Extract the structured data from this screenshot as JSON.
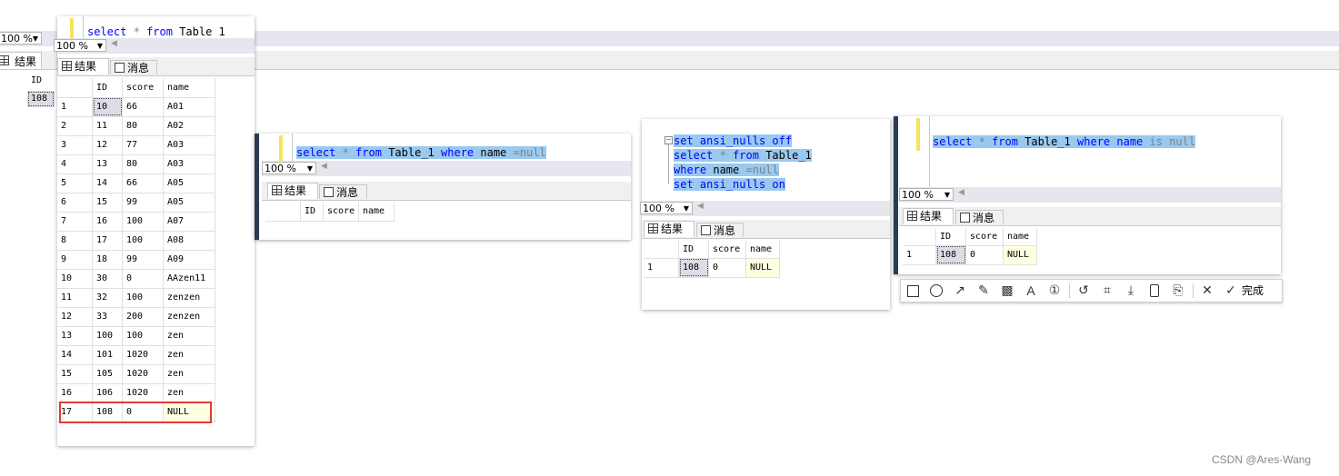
{
  "background_window": {
    "zoom": "100 %",
    "tab_results": "结果",
    "col_id": "ID",
    "cell_id": "108"
  },
  "panel1": {
    "sql": {
      "kw_select": "select",
      "star": "*",
      "kw_from": "from",
      "table": "Table 1"
    },
    "zoom": "100 %",
    "tab_results": "结果",
    "tab_messages": "消息",
    "columns": [
      "ID",
      "score",
      "name"
    ],
    "rows": [
      [
        "1",
        "10",
        "66",
        "A01"
      ],
      [
        "2",
        "11",
        "80",
        "A02"
      ],
      [
        "3",
        "12",
        "77",
        "A03"
      ],
      [
        "4",
        "13",
        "80",
        "A03"
      ],
      [
        "5",
        "14",
        "66",
        "A05"
      ],
      [
        "6",
        "15",
        "99",
        "A05"
      ],
      [
        "7",
        "16",
        "100",
        "A07"
      ],
      [
        "8",
        "17",
        "100",
        "A08"
      ],
      [
        "9",
        "18",
        "99",
        "A09"
      ],
      [
        "10",
        "30",
        "0",
        "AAzen11"
      ],
      [
        "11",
        "32",
        "100",
        "zenzen"
      ],
      [
        "12",
        "33",
        "200",
        "zenzen"
      ],
      [
        "13",
        "100",
        "100",
        "zen"
      ],
      [
        "14",
        "101",
        "1020",
        "zen"
      ],
      [
        "15",
        "105",
        "1020",
        "zen"
      ],
      [
        "16",
        "106",
        "1020",
        "zen"
      ],
      [
        "17",
        "108",
        "0",
        "NULL"
      ]
    ],
    "highlight_color": "#e53935"
  },
  "panel2": {
    "sql": {
      "kw_select": "select",
      "star": "*",
      "kw_from": "from",
      "table": "Table_1",
      "kw_where": "where",
      "col": "name",
      "op": "=null"
    },
    "zoom": "100 %",
    "tab_results": "结果",
    "tab_messages": "消息",
    "columns": [
      "ID",
      "score",
      "name"
    ]
  },
  "panel3": {
    "sql_lines": [
      {
        "a": "set",
        "b": "ansi_nulls",
        "c": "off"
      },
      {
        "a": "select",
        "b": "*",
        "c": "from",
        "d": "Table_1"
      },
      {
        "a": "where",
        "b": "name",
        "c": "=null"
      },
      {
        "a": "set",
        "b": "ansi_nulls",
        "c": "on"
      }
    ],
    "zoom": "100 %",
    "tab_results": "结果",
    "tab_messages": "消息",
    "columns": [
      "ID",
      "score",
      "name"
    ],
    "rows": [
      [
        "1",
        "108",
        "0",
        "NULL"
      ]
    ]
  },
  "panel4": {
    "sql": {
      "kw_select": "select",
      "star": "*",
      "kw_from": "from",
      "table": "Table_1",
      "kw_where": "where",
      "col": "name",
      "op": "is null"
    },
    "zoom": "100 %",
    "tab_results": "结果",
    "tab_messages": "消息",
    "columns": [
      "ID",
      "score",
      "name"
    ],
    "rows": [
      [
        "1",
        "108",
        "0",
        "NULL"
      ]
    ]
  },
  "toolbar": {
    "icons": [
      "rectangle-icon",
      "ellipse-icon",
      "arrow-icon",
      "pencil-icon",
      "mosaic-icon",
      "text-icon",
      "number-icon",
      "undo-icon",
      "pin-icon",
      "download-icon",
      "save-icon",
      "bookmark-icon",
      "close-icon",
      "check-icon"
    ],
    "done_label": "完成"
  },
  "watermark": "CSDN @Ares-Wang"
}
